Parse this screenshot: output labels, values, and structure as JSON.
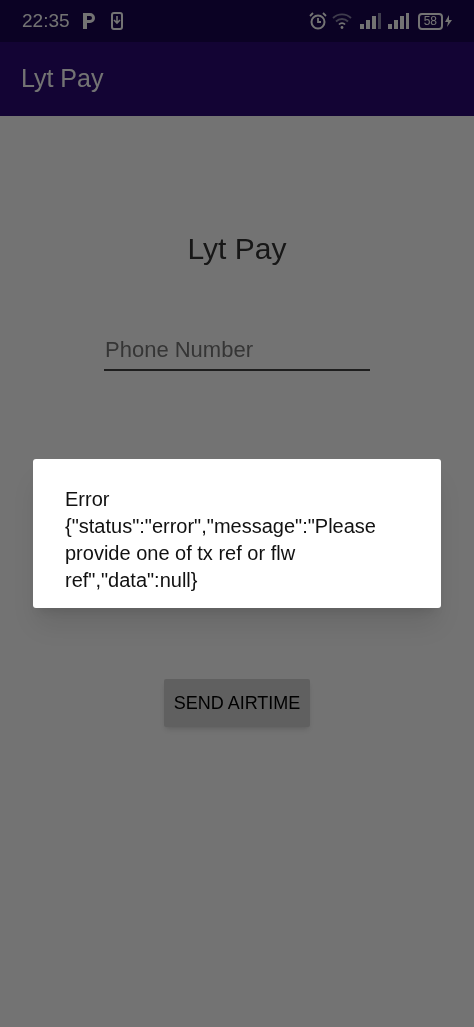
{
  "status_bar": {
    "time": "22:35",
    "battery": "58"
  },
  "app_bar": {
    "title": "Lyt Pay"
  },
  "heading": "Lyt Pay",
  "phone_field": {
    "placeholder": "Phone Number"
  },
  "send_button": "SEND AIRTIME",
  "dialog": {
    "message": "Error {\"status\":\"error\",\"message\":\"Please provide one of tx ref or flw ref\",\"data\":null}"
  }
}
